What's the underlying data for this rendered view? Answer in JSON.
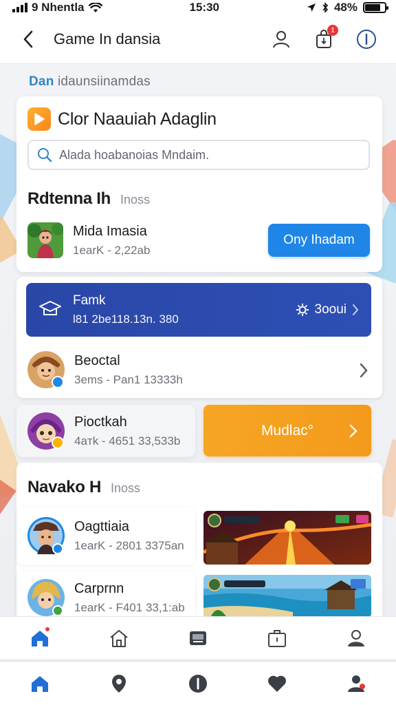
{
  "status_bar": {
    "carrier": "9 Nhentla",
    "time": "15:30",
    "battery": "48%",
    "battery_level": 0.8
  },
  "header": {
    "title": "Game In dansia",
    "back_icon": "chevron-left-icon",
    "notification_badge": "1"
  },
  "subtitle": {
    "accent": "Dan",
    "rest": " idaunsiinamdas"
  },
  "app": {
    "name": "Clor Naauiah Adaglin",
    "logo_icon": "play-icon"
  },
  "search": {
    "placeholder": "Alada hoabanoias Mndaim."
  },
  "section1": {
    "title": "Rdtenna Ih",
    "more": "Inoss"
  },
  "featured_game": {
    "name": "Mida Imasia",
    "meta": "1earK - 2,22ab",
    "button": "Ony Ihadam"
  },
  "banner": {
    "title": "Famk",
    "stats": "l81 2be118.13n. 380",
    "right": "3ooui"
  },
  "list": [
    {
      "name": "Beoctal",
      "meta": "3ems - Pan1 13333h"
    },
    {
      "name": "Pioctkah",
      "meta": "4aтk - 4651 33,533b"
    }
  ],
  "orange_button": {
    "label": "Mudlac°"
  },
  "section2": {
    "title": "Navako H",
    "more": "Inoss"
  },
  "lower_list": [
    {
      "name": "Oagttiaia",
      "meta": "1earK - 2801 3375an"
    },
    {
      "name": "Carprnn",
      "meta": "1earK - F401 33,1:ab"
    }
  ],
  "colors": {
    "accent_blue": "#1f86e8",
    "banner_blue": "#2a47a7",
    "orange": "#f6a623",
    "badge_red": "#e53935"
  },
  "tab_bar_1": [
    "home-icon",
    "house-outline-icon",
    "tv-icon",
    "briefcase-icon",
    "profile-icon"
  ],
  "tab_bar_2": [
    "home-icon",
    "location-pin-icon",
    "info-icon",
    "heart-icon",
    "users-icon"
  ]
}
